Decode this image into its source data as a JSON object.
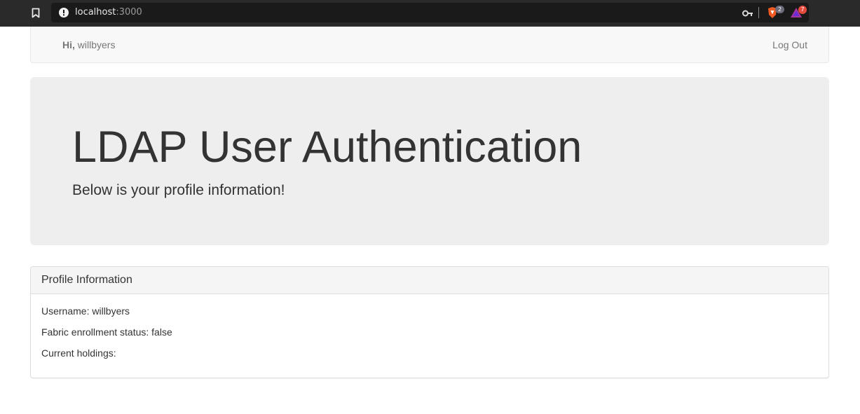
{
  "browser": {
    "url_host": "localhost",
    "url_port": ":3000",
    "shield_count": "2",
    "rewards_count": "7",
    "icons": [
      "bookmark-icon",
      "info-icon",
      "key-icon",
      "brave-shield-icon",
      "brave-rewards-icon"
    ]
  },
  "navbar": {
    "greeting_prefix": "Hi,",
    "username": "willbyers",
    "logout_label": "Log Out"
  },
  "jumbotron": {
    "title": "LDAP User Authentication",
    "lead": "Below is your profile information!"
  },
  "profile_panel": {
    "title": "Profile Information",
    "username_line": "Username: willbyers",
    "fabric_line": "Fabric enrollment status: false",
    "holdings_line": "Current holdings:"
  },
  "colors": {
    "browser_bar": "#2b2a2a",
    "navbar_bg": "#f8f8f8",
    "jumbotron_bg": "#eeeeee",
    "panel_heading_bg": "#f5f5f5",
    "text": "#333333",
    "muted_text": "#777777"
  }
}
